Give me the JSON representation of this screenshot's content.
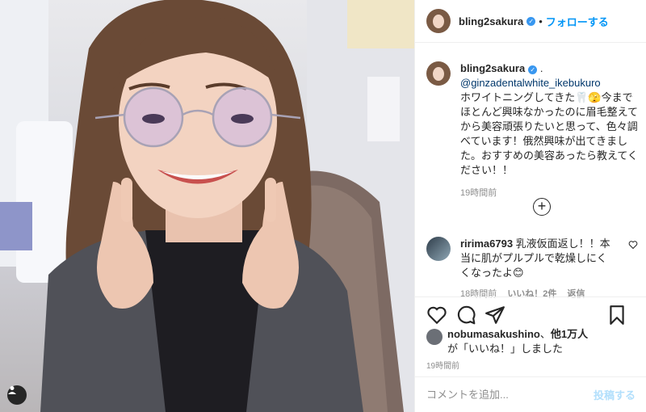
{
  "header": {
    "username": "bling2sakura",
    "separator": "•",
    "follow_label": "フォローする"
  },
  "caption": {
    "username": "bling2sakura",
    "suffix": " .",
    "mention": "@ginzadentalwhite_ikebukuro",
    "text": "ホワイトニングしてきた🦷🫣今までほとんど興味なかったのに眉毛整えてから美容頑張りたいと思って、色々調べています！俄然興味が出てきました。おすすめの美容あったら教えてください！！",
    "time": "19時間前"
  },
  "comment": {
    "username": "ririma6793",
    "text": " 乳液仮面返し！！本当に肌がプルプルで乾燥しにくくなったよ😊",
    "time": "18時間前",
    "likes": "いいね！2件",
    "reply": "返信"
  },
  "likes": {
    "liker": "nobumasakushino",
    "others_prefix": "、",
    "others": "他1万人",
    "suffix": "が「いいね！」しました"
  },
  "posted": "19時間前",
  "add_comment": {
    "placeholder": "コメントを追加...",
    "post_label": "投稿する"
  },
  "colors": {
    "accent": "#0095f6",
    "verified": "#3897f0",
    "muted": "#8e8e8e",
    "post_disabled": "#b2dffc"
  }
}
